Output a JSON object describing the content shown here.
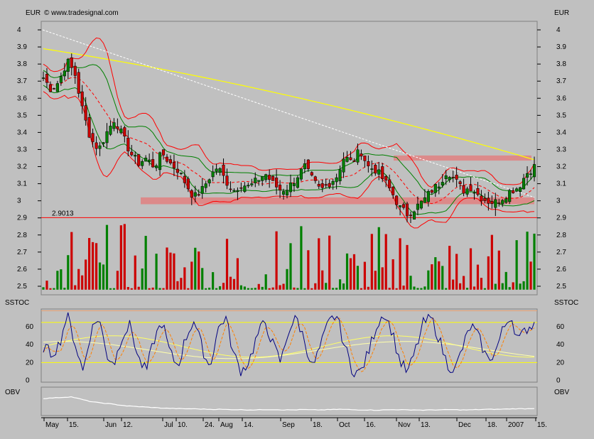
{
  "header": {
    "currency_left": "EUR",
    "currency_right": "EUR",
    "copyright": "© www.tradesignal.com"
  },
  "panels": {
    "sstoc_left": "SSTOC",
    "sstoc_right": "SSTOC",
    "obv_left": "OBV",
    "obv_right": "OBV"
  },
  "colors": {
    "background": "#c0c0c0",
    "up_candle": "#008000",
    "down_candle": "#cc0000",
    "bollinger": "#ff0000",
    "keltner": "#008000",
    "ma_200": "#ffff00",
    "trendline": "#ffffff",
    "support_zone": "#e08080",
    "stoch_fast": "#000080",
    "stoch_slow": "#ff8000",
    "obv_line": "#ffffff"
  },
  "chart_data": [
    {
      "type": "candlestick",
      "panel": "price",
      "ylabel": "EUR",
      "ylim": [
        2.45,
        4.05
      ],
      "yticks": [
        4,
        3.9,
        3.8,
        3.7,
        3.6,
        3.5,
        3.4,
        3.3,
        3.2,
        3.1,
        3,
        2.9,
        2.8,
        2.7,
        2.6,
        2.5
      ],
      "xtick_labels": [
        "May",
        "15.",
        "Jun",
        "12.",
        "Jul",
        "10.",
        "24.",
        "Aug",
        "14.",
        "Sep",
        "18.",
        "Oct",
        "16.",
        "Nov",
        "13.",
        "Dec",
        "18.",
        "2007",
        "15."
      ],
      "reference_line": {
        "value": 2.9013,
        "label": "2.9013"
      },
      "zones": [
        {
          "from_label": "Jun 12.",
          "to_label": "15.",
          "low": 2.98,
          "high": 3.02
        },
        {
          "from_label": "Oct 16.",
          "to_label": "15.",
          "low": 3.235,
          "high": 3.265
        }
      ],
      "close_path": [
        3.72,
        3.65,
        3.7,
        3.82,
        3.74,
        3.52,
        3.36,
        3.3,
        3.4,
        3.48,
        3.38,
        3.28,
        3.22,
        3.25,
        3.2,
        3.28,
        3.22,
        3.18,
        3.1,
        3.02,
        3.06,
        3.14,
        3.2,
        3.12,
        3.06,
        3.1,
        3.08,
        3.12,
        3.16,
        3.1,
        3.06,
        3.08,
        3.14,
        3.2,
        3.12,
        3.06,
        3.1,
        3.14,
        3.26,
        3.22,
        3.3,
        3.2,
        3.18,
        3.12,
        3.05,
        2.96,
        2.92,
        2.96,
        3.0,
        3.06,
        3.1,
        3.18,
        3.12,
        3.06,
        3.08,
        3.03,
        3.0,
        2.99,
        3.02,
        3.06,
        3.08,
        3.16,
        3.2
      ],
      "volume_bars": 40,
      "volume_ylim": [
        2.48,
        2.86
      ]
    },
    {
      "type": "line",
      "panel": "sstoc",
      "ylabel": "SSTOC",
      "ylim": [
        -2,
        80
      ],
      "yticks_left": [
        60,
        40,
        20,
        0
      ],
      "yticks_right": [
        60,
        40,
        20,
        0
      ],
      "levels": [
        65,
        20
      ],
      "fast_line": [
        38,
        30,
        40,
        74,
        42,
        10,
        55,
        72,
        28,
        20,
        52,
        62,
        24,
        10,
        46,
        66,
        30,
        16,
        48,
        68,
        38,
        14,
        56,
        72,
        30,
        10,
        22,
        50,
        66,
        40,
        20,
        58,
        70,
        44,
        14,
        38,
        64,
        74,
        40,
        12,
        8,
        30,
        60,
        76,
        56,
        22,
        8,
        34,
        64,
        70,
        46,
        18,
        12,
        38,
        62,
        48,
        24,
        30,
        56,
        74,
        44,
        58,
        64
      ]
    },
    {
      "type": "line",
      "panel": "obv",
      "ylabel": "OBV",
      "obv_line": [
        0.6,
        0.62,
        0.64,
        0.66,
        0.58,
        0.5,
        0.45,
        0.42,
        0.38,
        0.34,
        0.32,
        0.3,
        0.28,
        0.26,
        0.25,
        0.24,
        0.24,
        0.23,
        0.22,
        0.22,
        0.21,
        0.21,
        0.2,
        0.2,
        0.21,
        0.21,
        0.2,
        0.2,
        0.21,
        0.2,
        0.2,
        0.21,
        0.22,
        0.21,
        0.2,
        0.2,
        0.19,
        0.2,
        0.21,
        0.2,
        0.2,
        0.19,
        0.2,
        0.2,
        0.21,
        0.2,
        0.2,
        0.21,
        0.22,
        0.22,
        0.23,
        0.24,
        0.24,
        0.25
      ]
    }
  ]
}
